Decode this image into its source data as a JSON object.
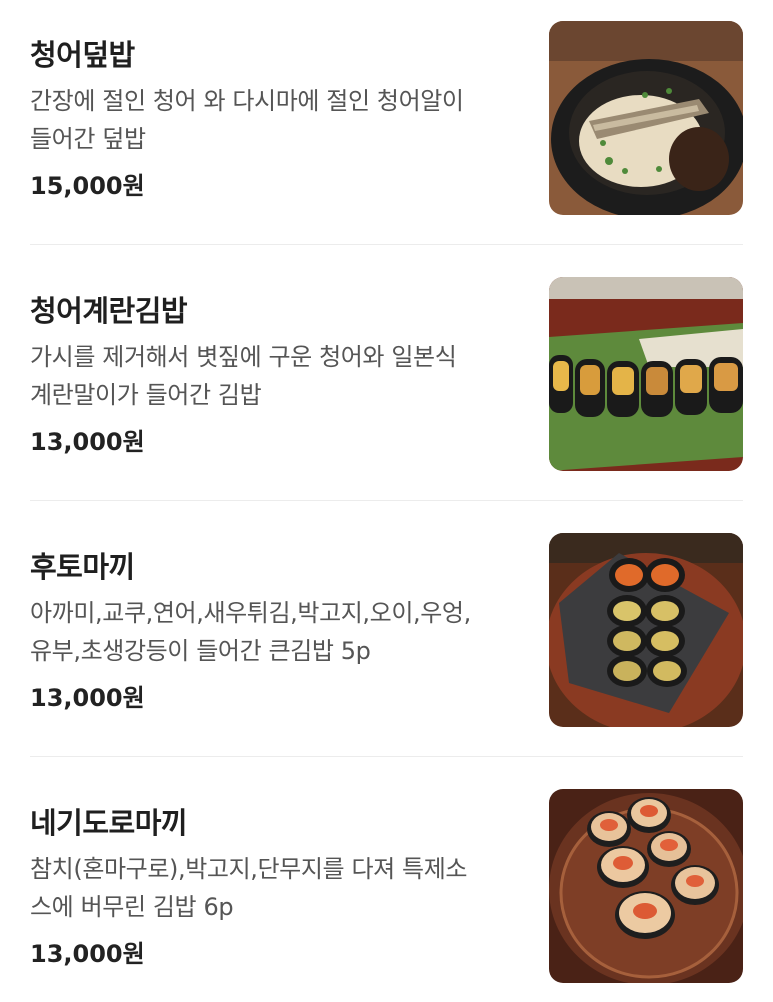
{
  "menu": {
    "items": [
      {
        "name": "청어덮밥",
        "description_lines": [
          "간장에 절인 청어 와 다시마에 절인 청어알이",
          "들어간 덮밥"
        ],
        "price": "15,000원",
        "photo_icon": "herring-rice-bowl-photo"
      },
      {
        "name": "청어계란김밥",
        "description_lines": [
          "가시를 제거해서 볏짚에 구운 청어와 일본식",
          "계란말이가 들어간 김밥"
        ],
        "price": "13,000원",
        "photo_icon": "herring-egg-gimbap-photo"
      },
      {
        "name": "후토마끼",
        "description_lines": [
          "아까미,교쿠,연어,새우튀김,박고지,오이,우엉,",
          "유부,초생강등이 들어간 큰김밥 5p"
        ],
        "price": "13,000원",
        "photo_icon": "futomaki-photo"
      },
      {
        "name": "네기도로마끼",
        "description_lines": [
          "참치(혼마구로),박고지,단무지를 다져 특제소",
          "스에 버무린 김밥 6p"
        ],
        "price": "13,000원",
        "photo_icon": "negitoro-maki-photo"
      }
    ]
  }
}
